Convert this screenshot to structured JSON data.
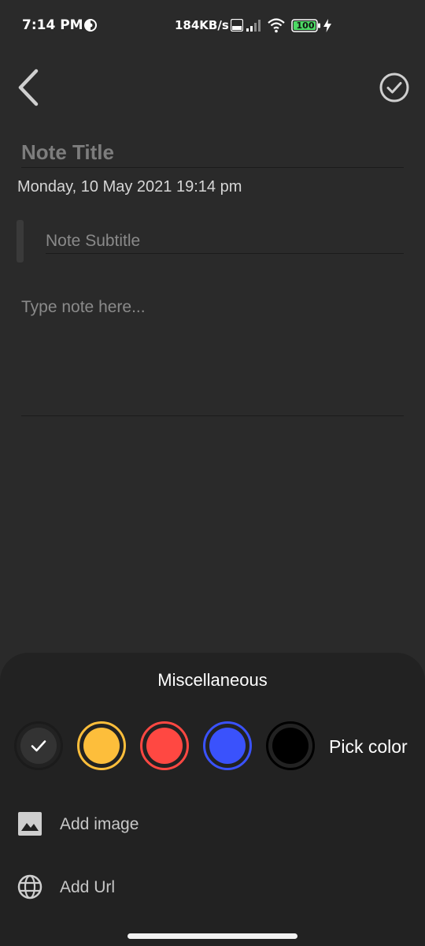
{
  "status_bar": {
    "time": "7:14 PM",
    "net_speed": "184KB/s",
    "battery_level": "100",
    "dnd_icon": "do-not-disturb-icon",
    "signal_icon": "cell-signal-icon",
    "wifi_icon": "wifi-icon",
    "charging_icon": "charging-bolt-icon"
  },
  "toolbar": {
    "back_icon": "chevron-left-icon",
    "done_icon": "check-circle-icon"
  },
  "note": {
    "title_placeholder": "Note Title",
    "datetime": "Monday, 10 May 2021 19:14 pm",
    "subtitle_placeholder": "Note Subtitle",
    "body_placeholder": "Type note here..."
  },
  "misc_sheet": {
    "title": "Miscellaneous",
    "colors": [
      {
        "name": "default",
        "fill": "#333333",
        "ring": "#1b1b1b",
        "selected": true
      },
      {
        "name": "yellow",
        "fill": "#FDBE3B",
        "ring": "#FDBE3B",
        "selected": false
      },
      {
        "name": "red",
        "fill": "#FF4842",
        "ring": "#FF4842",
        "selected": false
      },
      {
        "name": "blue",
        "fill": "#3A52FC",
        "ring": "#3A52FC",
        "selected": false
      },
      {
        "name": "black",
        "fill": "#000000",
        "ring": "#000000",
        "selected": false
      }
    ],
    "pick_color_label": "Pick color",
    "add_image_label": "Add image",
    "add_url_label": "Add Url"
  },
  "colors": {
    "background": "#2a2a2a",
    "sheet": "#222222",
    "placeholder": "#8a8a8a"
  }
}
